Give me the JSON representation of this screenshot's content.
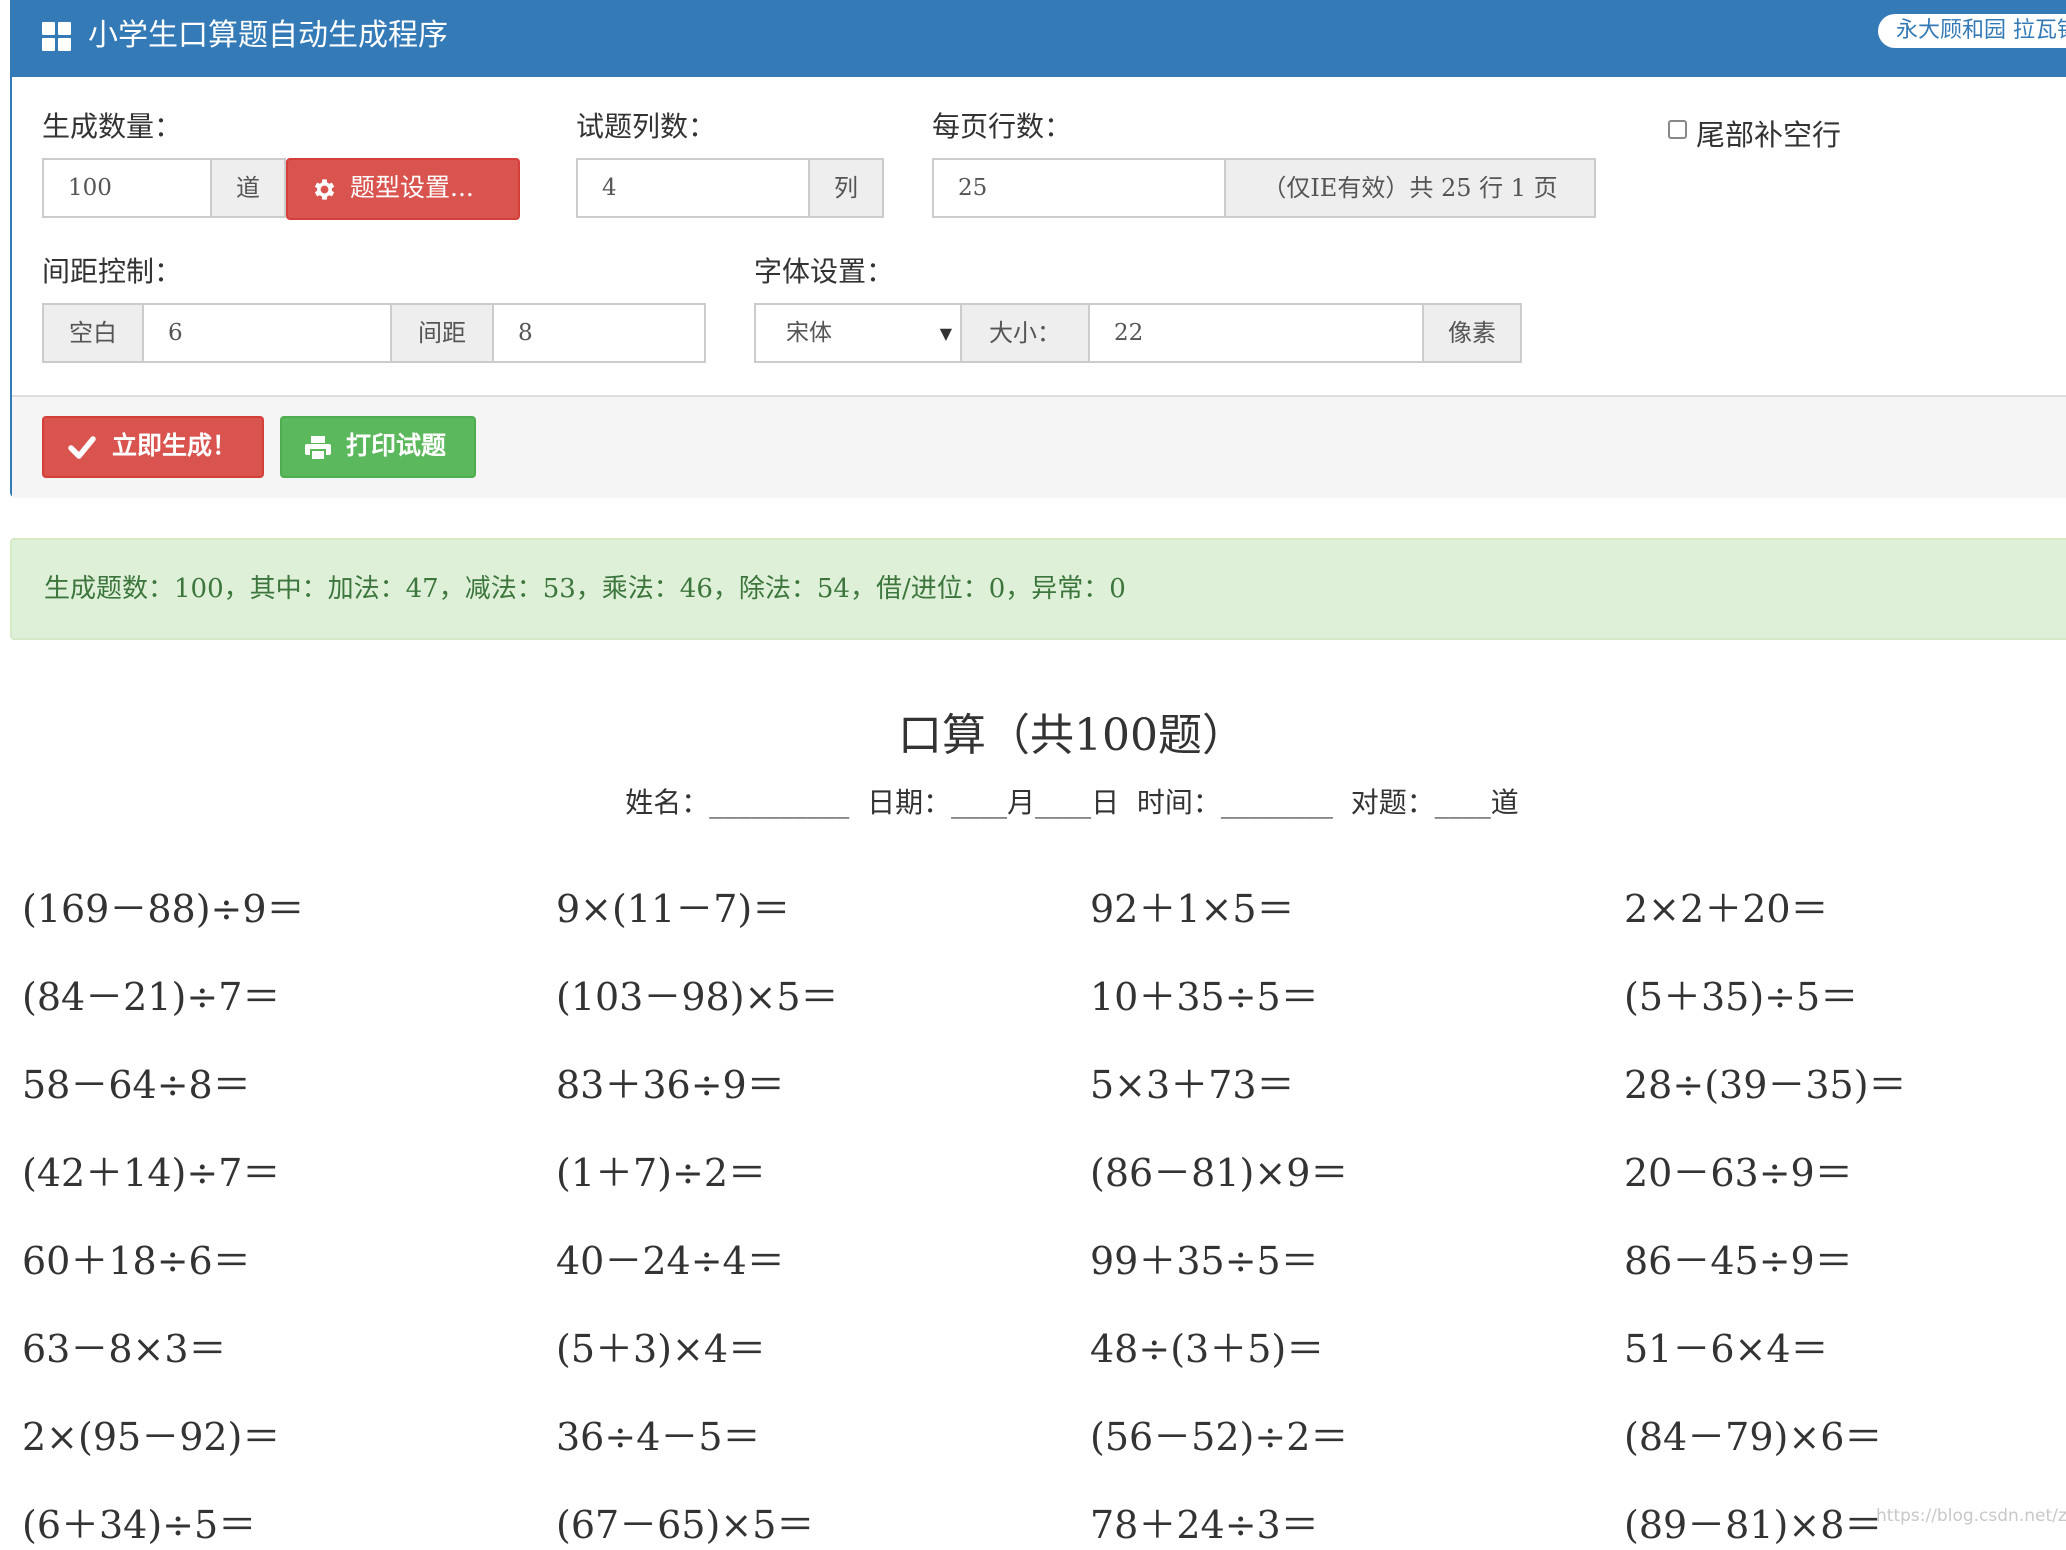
{
  "header": {
    "title": "小学生口算题自动生成程序",
    "badge": "永大顾和园 拉瓦锡"
  },
  "form": {
    "count_label": "生成数量：",
    "count_value": "100",
    "count_unit": "道",
    "type_settings_button": "题型设置...",
    "columns_label": "试题列数：",
    "columns_value": "4",
    "columns_unit": "列",
    "rows_label": "每页行数：",
    "rows_value": "25",
    "rows_info": "（仅IE有效）共 25 行 1 页",
    "pad_rows_label": "尾部补空行",
    "pad_rows_checked": false,
    "spacing_label": "间距控制：",
    "blank_addon": "空白",
    "blank_value": "6",
    "gap_addon": "间距",
    "gap_value": "8",
    "font_label": "字体设置：",
    "font_family": "宋体",
    "size_addon": "大小：",
    "size_value": "22",
    "size_unit": "像素",
    "generate_button": "立即生成！",
    "print_button": "打印试题"
  },
  "stats": "生成题数：100，其中：加法：47，减法：53，乘法：46，除法：54，借/进位：0，异常：0",
  "sheet": {
    "title": "口算（共100题）",
    "subtitle": "姓名：__________  日期：____月____日  时间：________  对题：____道"
  },
  "problems": [
    [
      "(169－88)÷9＝",
      "9×(11－7)＝",
      "92＋1×5＝",
      "2×2＋20＝"
    ],
    [
      "(84－21)÷7＝",
      "(103－98)×5＝",
      "10＋35÷5＝",
      "(5＋35)÷5＝"
    ],
    [
      "58－64÷8＝",
      "83＋36÷9＝",
      "5×3＋73＝",
      "28÷(39－35)＝"
    ],
    [
      "(42＋14)÷7＝",
      "(1＋7)÷2＝",
      "(86－81)×9＝",
      "20－63÷9＝"
    ],
    [
      "60＋18÷6＝",
      "40－24÷4＝",
      "99＋35÷5＝",
      "86－45÷9＝"
    ],
    [
      "63－8×3＝",
      "(5＋3)×4＝",
      "48÷(3＋5)＝",
      "51－6×4＝"
    ],
    [
      "2×(95－92)＝",
      "36÷4－5＝",
      "(56－52)÷2＝",
      "(84－79)×6＝"
    ],
    [
      "(6＋34)÷5＝",
      "(67－65)×5＝",
      "78＋24÷3＝",
      "(89－81)×8＝"
    ]
  ],
  "watermark": "https://blog.csdn.net/zhide"
}
